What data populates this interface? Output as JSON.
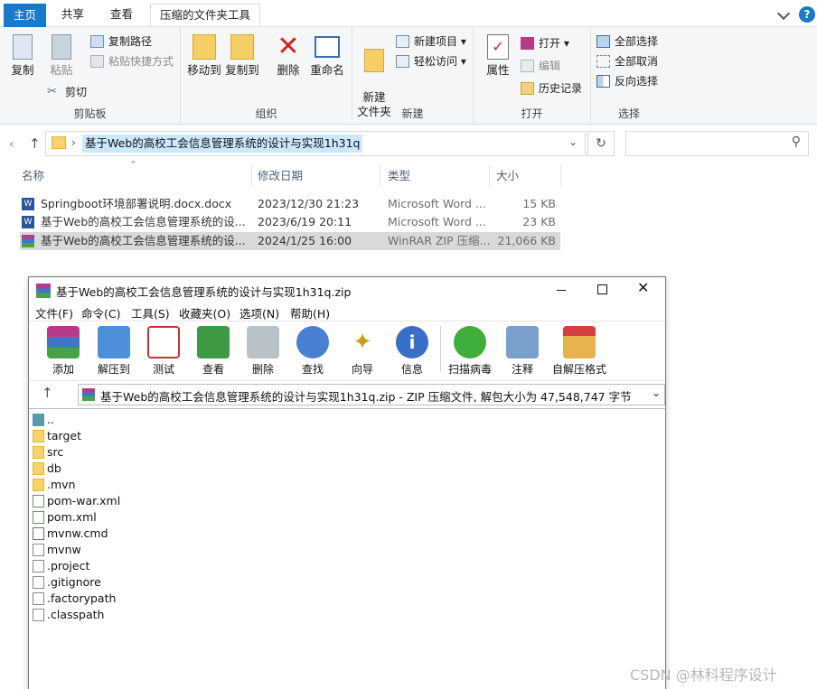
{
  "explorer": {
    "tabs": [
      "主页",
      "共享",
      "查看",
      "压缩的文件夹工具"
    ],
    "help_icon": "?",
    "ribbon": {
      "clipboard": {
        "label": "剪贴板",
        "copy": "复制",
        "paste": "粘贴",
        "copy_path": "复制路径",
        "paste_shortcut": "粘贴快捷方式",
        "cut": "剪切"
      },
      "organize": {
        "label": "组织",
        "move_to": "移动到",
        "copy_to": "复制到",
        "delete": "删除",
        "rename": "重命名"
      },
      "new": {
        "label": "新建",
        "new_folder": "新建\n文件夹",
        "new_item": "新建项目",
        "easy_access": "轻松访问"
      },
      "open": {
        "label": "打开",
        "properties": "属性",
        "open": "打开",
        "edit": "编辑",
        "history": "历史记录"
      },
      "select": {
        "label": "选择",
        "select_all": "全部选择",
        "select_none": "全部取消",
        "invert": "反向选择"
      }
    },
    "address": "基于Web的高校工会信息管理系统的设计与实现1h31q",
    "columns": {
      "name": "名称",
      "modified": "修改日期",
      "type": "类型",
      "size": "大小"
    },
    "files": [
      {
        "name": "Springboot环境部署说明.docx.docx",
        "date": "2023/12/30 21:23",
        "type": "Microsoft Word ...",
        "size": "15 KB",
        "icon": "word-icon"
      },
      {
        "name": "基于Web的高校工会信息管理系统的设...",
        "date": "2023/6/19 20:11",
        "type": "Microsoft Word ...",
        "size": "23 KB",
        "icon": "word-icon"
      },
      {
        "name": "基于Web的高校工会信息管理系统的设...",
        "date": "2024/1/25 16:00",
        "type": "WinRAR ZIP 压缩...",
        "size": "21,066 KB",
        "icon": "winrar-icon"
      }
    ]
  },
  "winrar": {
    "title": "基于Web的高校工会信息管理系统的设计与实现1h31q.zip",
    "menus": [
      "文件(F)",
      "命令(C)",
      "工具(S)",
      "收藏夹(O)",
      "选项(N)",
      "帮助(H)"
    ],
    "toolbar": [
      "添加",
      "解压到",
      "测试",
      "查看",
      "删除",
      "查找",
      "向导",
      "信息",
      "扫描病毒",
      "注释",
      "自解压格式"
    ],
    "path": "基于Web的高校工会信息管理系统的设计与实现1h31q.zip - ZIP 压缩文件, 解包大小为 47,548,747 字节",
    "items": [
      {
        "name": "..",
        "kind": "up"
      },
      {
        "name": "target",
        "kind": "folder"
      },
      {
        "name": "src",
        "kind": "folder"
      },
      {
        "name": "db",
        "kind": "folder"
      },
      {
        "name": ".mvn",
        "kind": "folder"
      },
      {
        "name": "pom-war.xml",
        "kind": "xml"
      },
      {
        "name": "pom.xml",
        "kind": "xml"
      },
      {
        "name": "mvnw.cmd",
        "kind": "cmd"
      },
      {
        "name": "mvnw",
        "kind": "file"
      },
      {
        "name": ".project",
        "kind": "file"
      },
      {
        "name": ".gitignore",
        "kind": "file"
      },
      {
        "name": ".factorypath",
        "kind": "file"
      },
      {
        "name": ".classpath",
        "kind": "file"
      }
    ]
  },
  "watermark": "CSDN @林科程序设计",
  "colors": {
    "accent": "#1979ca",
    "selection": "#d9d9d9",
    "folder": "#f7d36a"
  }
}
